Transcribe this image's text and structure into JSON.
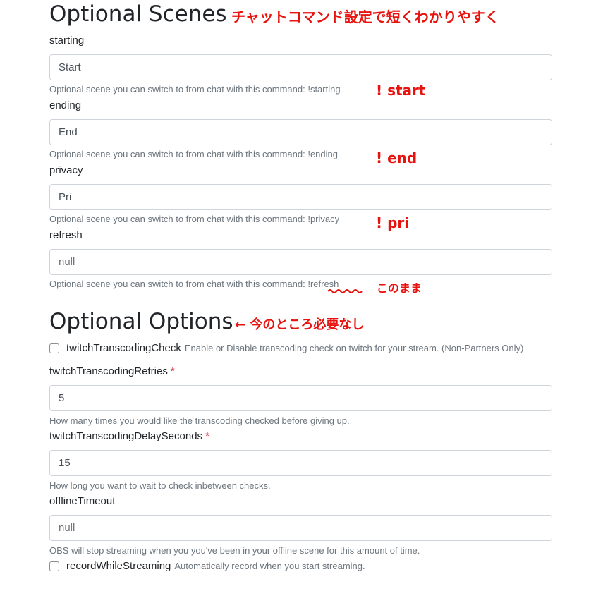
{
  "sections": {
    "scenes_title": "Optional Scenes",
    "options_title": "Optional Options"
  },
  "scenes": [
    {
      "label": "starting",
      "value": "Start",
      "placeholder": "",
      "help": "Optional scene you can switch to from chat with this command: !starting",
      "annotation": "! start"
    },
    {
      "label": "ending",
      "value": "End",
      "placeholder": "",
      "help": "Optional scene you can switch to from chat with this command: !ending",
      "annotation": "! end"
    },
    {
      "label": "privacy",
      "value": "Pri",
      "placeholder": "",
      "help": "Optional scene you can switch to from chat with this command: !privacy",
      "annotation": "! pri"
    },
    {
      "label": "refresh",
      "value": "",
      "placeholder": "null",
      "help": "Optional scene you can switch to from chat with this command: !refresh",
      "annotation": "このまま"
    }
  ],
  "options": {
    "transcoding_check": {
      "label": "twitchTranscodingCheck",
      "desc": "Enable or Disable transcoding check on twitch for your stream. (Non-Partners Only)"
    },
    "retries": {
      "label": "twitchTranscodingRetries",
      "required": "*",
      "value": "5",
      "help": "How many times you would like the transcoding checked before giving up."
    },
    "delay": {
      "label": "twitchTranscodingDelaySeconds",
      "required": "*",
      "value": "15",
      "help": "How long you want to wait to check inbetween checks."
    },
    "offline_timeout": {
      "label": "offlineTimeout",
      "value": "",
      "placeholder": "null",
      "help": "OBS will stop streaming when you you've been in your offline scene for this amount of time."
    },
    "record": {
      "label": "recordWhileStreaming",
      "desc": "Automatically record when you start streaming."
    }
  },
  "annotations": {
    "scenes_note": "チャットコマンド設定で短くわかりやすく",
    "options_note": "← 今のところ必要なし"
  },
  "colors": {
    "annotation": "#e8130f",
    "required": "#dc3545",
    "help_text": "#6c757d",
    "input_border": "#ced4da"
  }
}
